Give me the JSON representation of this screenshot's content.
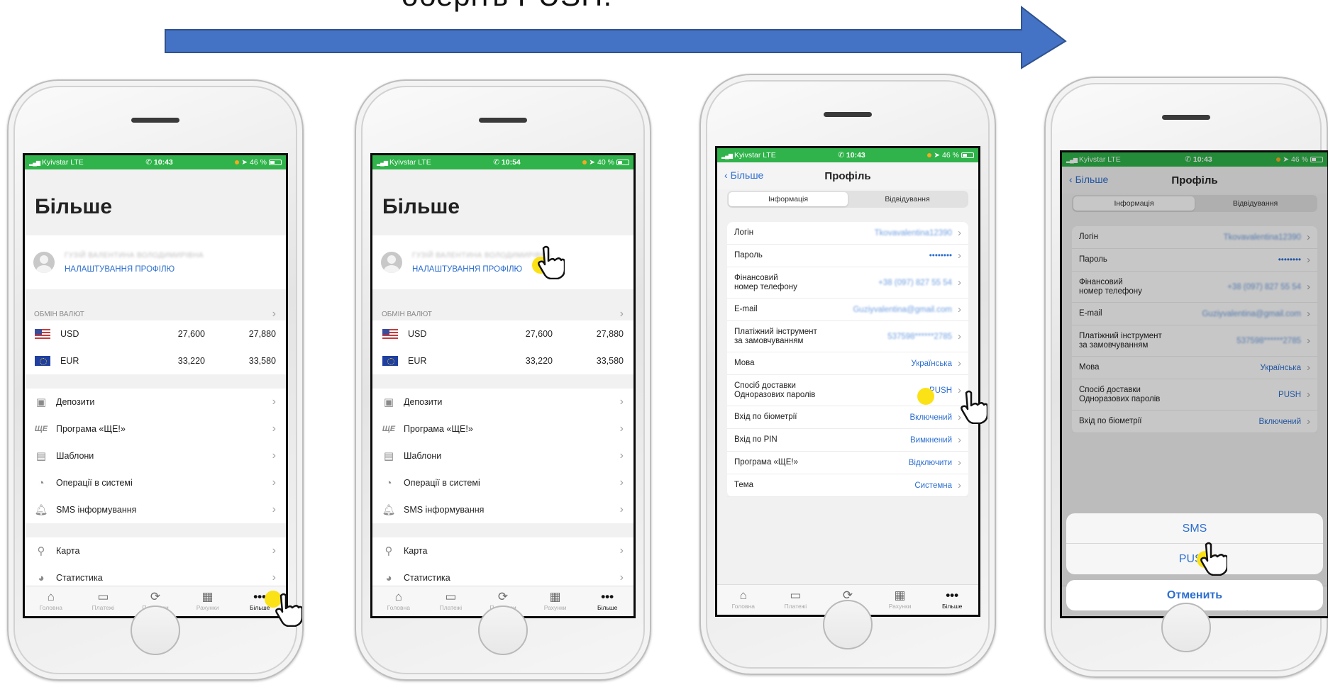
{
  "heading": "оберіть PUSH.",
  "colors": {
    "accent_green": "#2fb34a",
    "link_blue": "#2d6fd0",
    "arrow_blue": "#4472c4",
    "tap_yellow": "#fbe216"
  },
  "status": {
    "s1": {
      "carrier": "Kyivstar  LTE",
      "time": "10:43",
      "battery": "46 %",
      "battery_level": 0.46
    },
    "s2": {
      "carrier": "Kyivstar  LTE",
      "time": "10:54",
      "battery": "40 %",
      "battery_level": 0.4
    },
    "s3": {
      "carrier": "Kyivstar  LTE",
      "time": "10:43",
      "battery": "46 %",
      "battery_level": 0.46
    },
    "s4": {
      "carrier": "Kyivstar  LTE",
      "time": "10:43",
      "battery": "46 %",
      "battery_level": 0.46
    }
  },
  "more": {
    "title": "Більше",
    "profile_name": "ГУЗІЙ ВАЛЕНТИНА ВОЛОДИМИРІВНА",
    "profile_link": "НАЛАШТУВАННЯ ПРОФІЛЮ",
    "exchange_label": "ОБМІН ВАЛЮТ",
    "rates": [
      {
        "flag": "us-flag-icon",
        "currency": "USD",
        "buy": "27,600",
        "sell": "27,880"
      },
      {
        "flag": "eu-flag-icon",
        "currency": "EUR",
        "buy": "33,220",
        "sell": "33,580"
      }
    ],
    "menu1": [
      {
        "icon": "deposit-icon",
        "label": "Депозити"
      },
      {
        "icon": "she-program-icon",
        "label": "Програма «ЩЕ!»"
      },
      {
        "icon": "templates-icon",
        "label": "Шаблони"
      },
      {
        "icon": "clock-icon",
        "label": "Операції в системі"
      },
      {
        "icon": "bell-icon",
        "label": "SMS інформування"
      }
    ],
    "menu2": [
      {
        "icon": "map-pin-icon",
        "label": "Карта"
      },
      {
        "icon": "pie-chart-icon",
        "label": "Статистика"
      }
    ]
  },
  "tabs": [
    {
      "icon": "home-icon",
      "label": "Головна"
    },
    {
      "icon": "payments-icon",
      "label": "Платежі"
    },
    {
      "icon": "transfers-icon",
      "label": "Перекази"
    },
    {
      "icon": "accounts-icon",
      "label": "Рахунки"
    },
    {
      "icon": "more-icon",
      "label": "Більше"
    }
  ],
  "profile": {
    "back": "Більше",
    "title": "Профіль",
    "segments": [
      "Інформація",
      "Відвідування"
    ],
    "rows": [
      {
        "label": "Логін",
        "value": "Tkovavalentina12390",
        "blur": true
      },
      {
        "label": "Пароль",
        "value": "••••••••",
        "blur": false
      },
      {
        "label": "Фінансовий\nномер телефону",
        "value": "+38 (097) 827 55 54",
        "blur": true
      },
      {
        "label": "E-mail",
        "value": "Guziyvalentina@gmail.com",
        "blur": true
      },
      {
        "label": "Платіжний інструмент\nза замовчуванням",
        "value": "537598******2785",
        "blur": true
      },
      {
        "label": "Мова",
        "value": "Українська",
        "blur": false
      },
      {
        "label": "Спосіб доставки\nОдноразових паролів",
        "value": "PUSH",
        "blur": false
      },
      {
        "label": "Вхід по біометрії",
        "value": "Включений",
        "blur": false
      },
      {
        "label": "Вхід по PIN",
        "value": "Вимкнений",
        "blur": false
      },
      {
        "label": "Програма «ЩЕ!»",
        "value": "Відключити",
        "blur": false
      },
      {
        "label": "Тема",
        "value": "Системна",
        "blur": false
      }
    ]
  },
  "sheet": {
    "options": [
      "SMS",
      "PUSH"
    ],
    "cancel": "Отменить"
  }
}
